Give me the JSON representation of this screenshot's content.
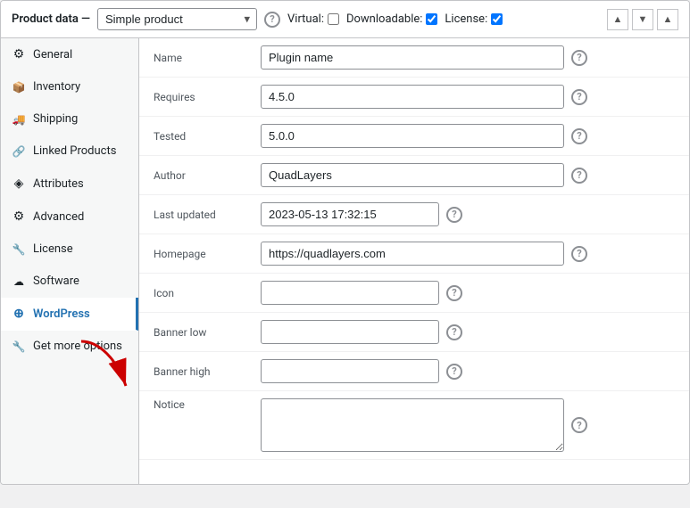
{
  "header": {
    "label": "Product data —",
    "product_type": "Simple product",
    "virtual_label": "Virtual:",
    "downloadable_label": "Downloadable:",
    "license_label": "License:"
  },
  "sidebar": {
    "items": [
      {
        "id": "general",
        "label": "General",
        "icon": "⚙"
      },
      {
        "id": "inventory",
        "label": "Inventory",
        "icon": "📦"
      },
      {
        "id": "shipping",
        "label": "Shipping",
        "icon": "🚚"
      },
      {
        "id": "linked-products",
        "label": "Linked Products",
        "icon": "🔗"
      },
      {
        "id": "attributes",
        "label": "Attributes",
        "icon": "◈"
      },
      {
        "id": "advanced",
        "label": "Advanced",
        "icon": "⚙"
      },
      {
        "id": "license",
        "label": "License",
        "icon": "🔧"
      },
      {
        "id": "software",
        "label": "Software",
        "icon": "☁"
      },
      {
        "id": "wordpress",
        "label": "WordPress",
        "icon": "⊕"
      },
      {
        "id": "get-more-options",
        "label": "Get more options",
        "icon": "🔧"
      }
    ]
  },
  "form": {
    "fields": [
      {
        "id": "name",
        "label": "Name",
        "value": "Plugin name",
        "type": "text",
        "size": "wide"
      },
      {
        "id": "requires",
        "label": "Requires",
        "value": "4.5.0",
        "type": "text",
        "size": "wide"
      },
      {
        "id": "tested",
        "label": "Tested",
        "value": "5.0.0",
        "type": "text",
        "size": "wide"
      },
      {
        "id": "author",
        "label": "Author",
        "value": "QuadLayers",
        "type": "text",
        "size": "wide"
      },
      {
        "id": "last-updated",
        "label": "Last updated",
        "value": "2023-05-13 17:32:15",
        "type": "text",
        "size": "datetime"
      },
      {
        "id": "homepage",
        "label": "Homepage",
        "value": "https://quadlayers.com",
        "type": "text",
        "size": "homepage"
      },
      {
        "id": "icon",
        "label": "Icon",
        "value": "",
        "type": "text",
        "size": "small"
      },
      {
        "id": "banner-low",
        "label": "Banner low",
        "value": "",
        "type": "text",
        "size": "small"
      },
      {
        "id": "banner-high",
        "label": "Banner high",
        "value": "",
        "type": "text",
        "size": "small"
      },
      {
        "id": "notice",
        "label": "Notice",
        "value": "",
        "type": "textarea",
        "size": "wide"
      }
    ]
  },
  "active_tab": "wordpress"
}
